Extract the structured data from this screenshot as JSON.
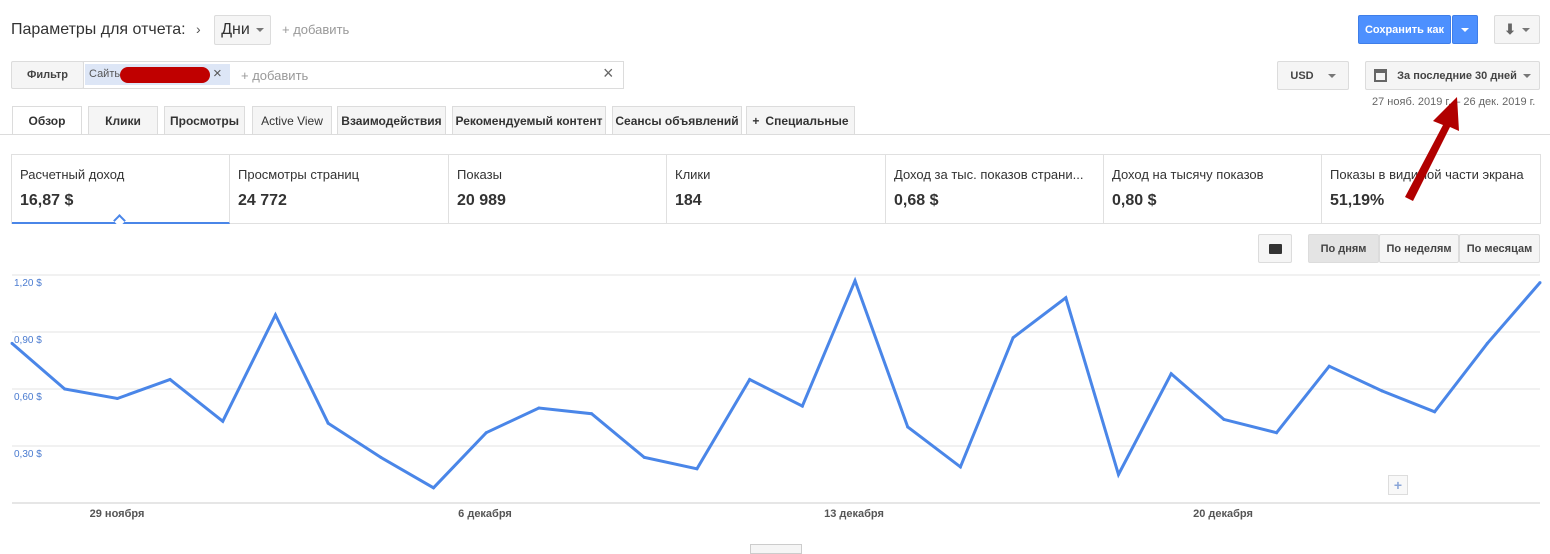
{
  "header": {
    "title": "Параметры для отчета:",
    "dimension": "Дни",
    "add_label": "+ добавить"
  },
  "toolbar": {
    "save_label": "Сохранить как",
    "currency": "USD",
    "date_range": "За последние 30 дней",
    "date_text": "27 нояб. 2019 г. – 26 дек. 2019 г.",
    "accent": "#4d90fe"
  },
  "filter": {
    "label": "Фильтр",
    "chip": "Сайть",
    "add_label": "+ добавить"
  },
  "tabs": [
    "Обзор",
    "Клики",
    "Просмотры",
    "Active View",
    "Взаимодействия",
    "Рекомендуемый контент",
    "Сеансы объявлений",
    "Специальные"
  ],
  "metrics": [
    {
      "label": "Расчетный доход",
      "value": "16,87 $"
    },
    {
      "label": "Просмотры страниц",
      "value": "24 772"
    },
    {
      "label": "Показы",
      "value": "20 989"
    },
    {
      "label": "Клики",
      "value": "184"
    },
    {
      "label": "Доход за тыс. показов страни...",
      "value": "0,68 $"
    },
    {
      "label": "Доход на тысячу показов",
      "value": "0,80 $"
    },
    {
      "label": "Показы в видимой части экрана",
      "value": "51,19%"
    }
  ],
  "granularity": {
    "options": [
      "По дням",
      "По неделям",
      "По месяцам"
    ],
    "selected": "По дням"
  },
  "chart_data": {
    "type": "line",
    "x": [
      "27 нояб.",
      "28 нояб.",
      "29 нояб.",
      "30 нояб.",
      "1 дек.",
      "2 дек.",
      "3 дек.",
      "4 дек.",
      "5 дек.",
      "6 дек.",
      "7 дек.",
      "8 дек.",
      "9 дек.",
      "10 дек.",
      "11 дек.",
      "12 дек.",
      "13 дек.",
      "14 дек.",
      "15 дек.",
      "16 дек.",
      "17 дек.",
      "18 дек.",
      "19 дек.",
      "20 дек.",
      "21 дек.",
      "22 дек.",
      "23 дек.",
      "24 дек.",
      "25 дек.",
      "26 дек."
    ],
    "values": [
      0.84,
      0.6,
      0.55,
      0.65,
      0.43,
      0.99,
      0.42,
      0.24,
      0.08,
      0.37,
      0.5,
      0.47,
      0.24,
      0.18,
      0.65,
      0.51,
      1.17,
      0.4,
      0.19,
      0.87,
      1.08,
      0.15,
      0.68,
      0.44,
      0.37,
      0.72,
      0.59,
      0.48,
      0.84,
      1.16
    ],
    "ylim": [
      0,
      1.2
    ],
    "yticks": [
      "0,30 $",
      "0,60 $",
      "0,90 $",
      "1,20 $"
    ],
    "xticks": [
      "29 ноября",
      "6 декабря",
      "13 декабря",
      "20 декабря"
    ],
    "grid": true,
    "color": "#4a86e8"
  }
}
